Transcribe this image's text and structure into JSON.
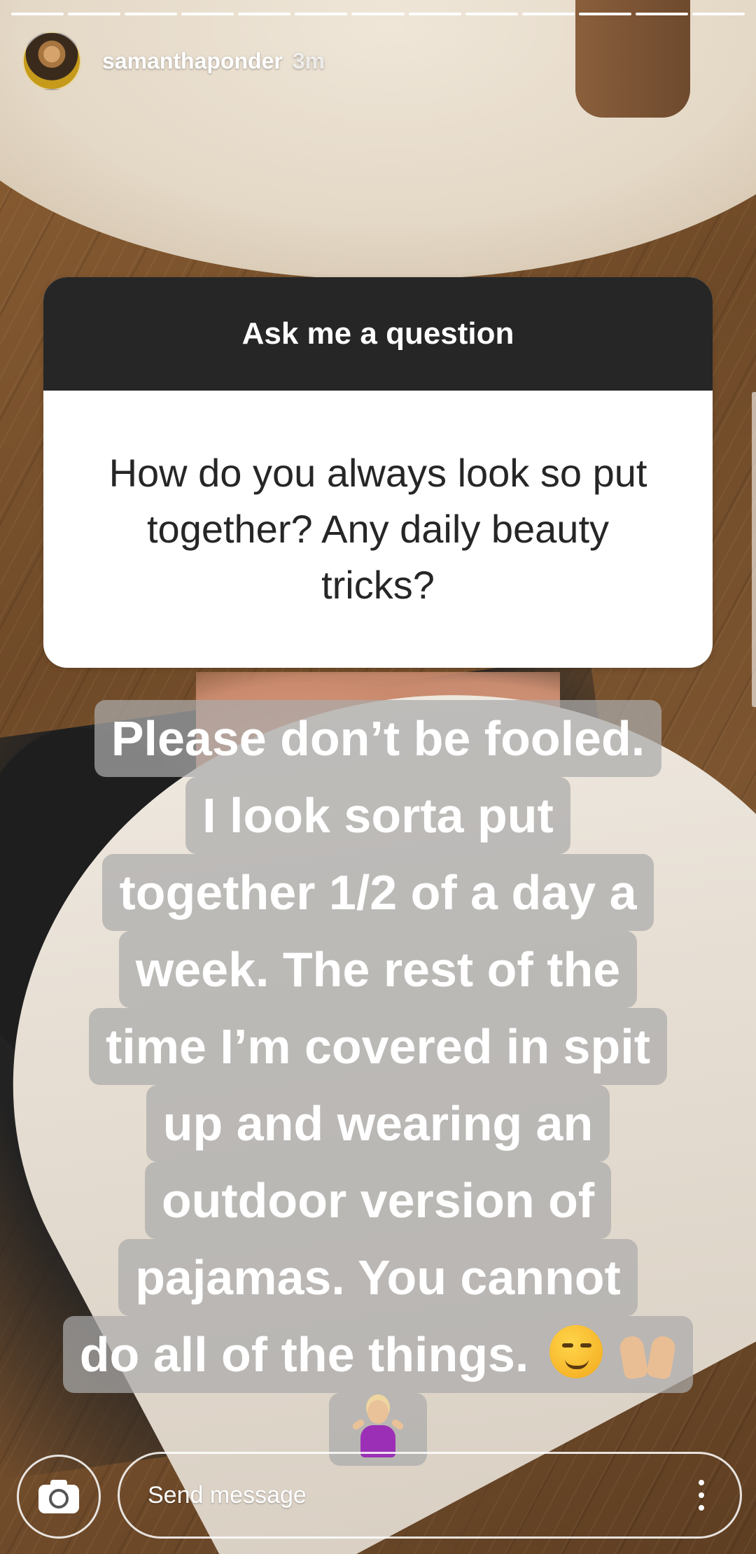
{
  "story": {
    "segment_count": 13,
    "username": "samanthaponder",
    "time_ago": "3m"
  },
  "question_sticker": {
    "title": "Ask me a question",
    "question": "How do you always look so put together? Any daily beauty tricks?"
  },
  "caption": {
    "lines": [
      "Please don’t be fooled.",
      "I look sorta put",
      "together 1/2 of a day a",
      "week. The rest of the",
      "time I’m covered in spit",
      "up and wearing an",
      "outdoor version of",
      "pajamas. You cannot",
      "do all of the things."
    ],
    "emojis": [
      "smirking-face",
      "raising-hands",
      "person-shrugging"
    ]
  },
  "reply_bar": {
    "placeholder": "Send message",
    "camera_icon": "camera-icon",
    "more_icon": "more-vertical-icon"
  },
  "colors": {
    "sticker_header": "#262626",
    "sticker_body": "#ffffff",
    "caption_highlight": "#aaaaaa"
  }
}
